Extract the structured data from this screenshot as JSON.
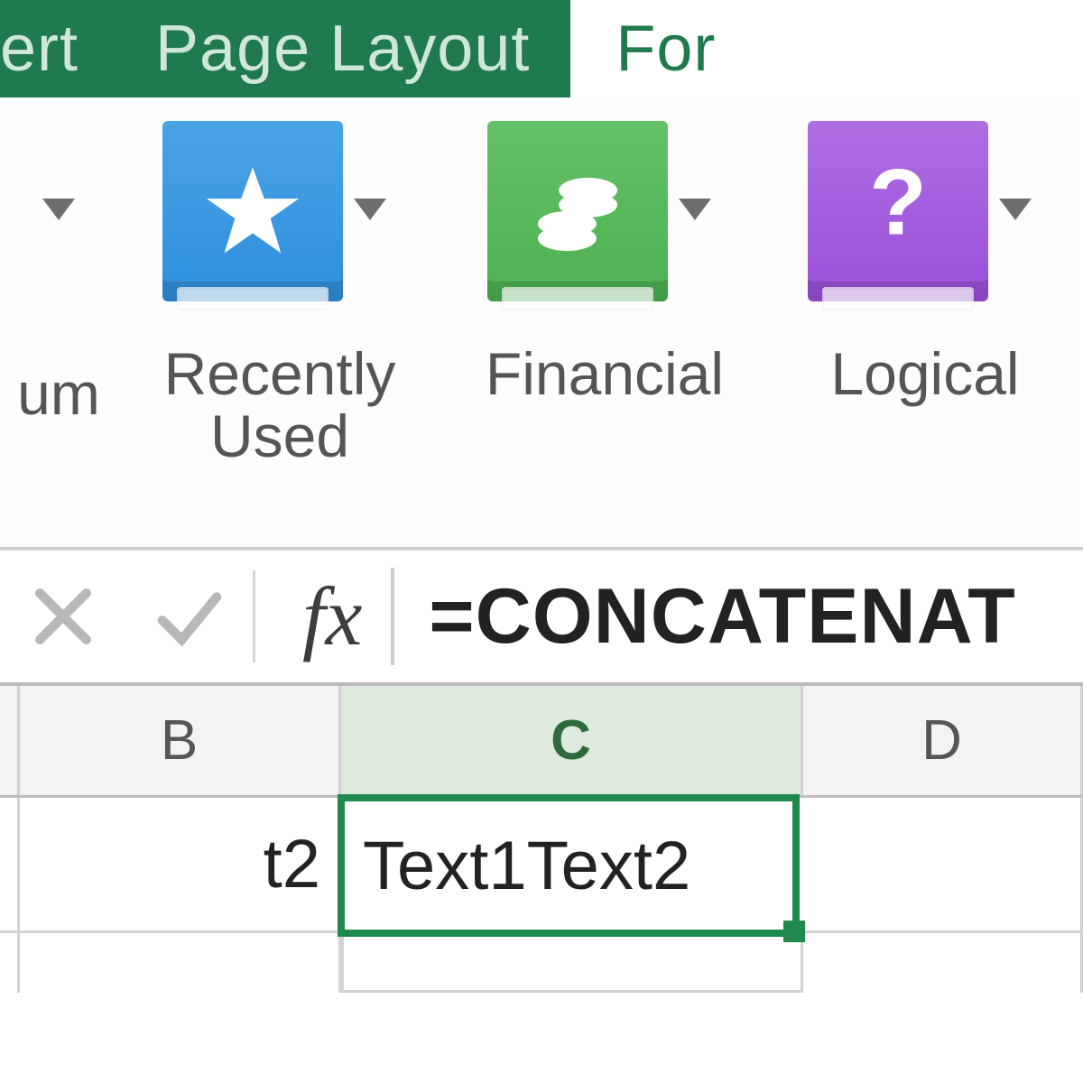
{
  "tabs": {
    "insert_partial": "ert",
    "page_layout": "Page Layout",
    "formulas_partial": "For"
  },
  "ribbon": {
    "autosum_partial": "um",
    "recently_used": "Recently\nUsed",
    "financial": "Financial",
    "logical": "Logical"
  },
  "formula_bar": {
    "fx_label": "fx",
    "formula": "=CONCATENAT"
  },
  "columns": {
    "b": "B",
    "c": "C",
    "d": "D"
  },
  "cells": {
    "b1_partial": "t2",
    "c1": "Text1Text2"
  },
  "colors": {
    "excel_green": "#1f7a4d",
    "selection_green": "#1f8a4c"
  }
}
